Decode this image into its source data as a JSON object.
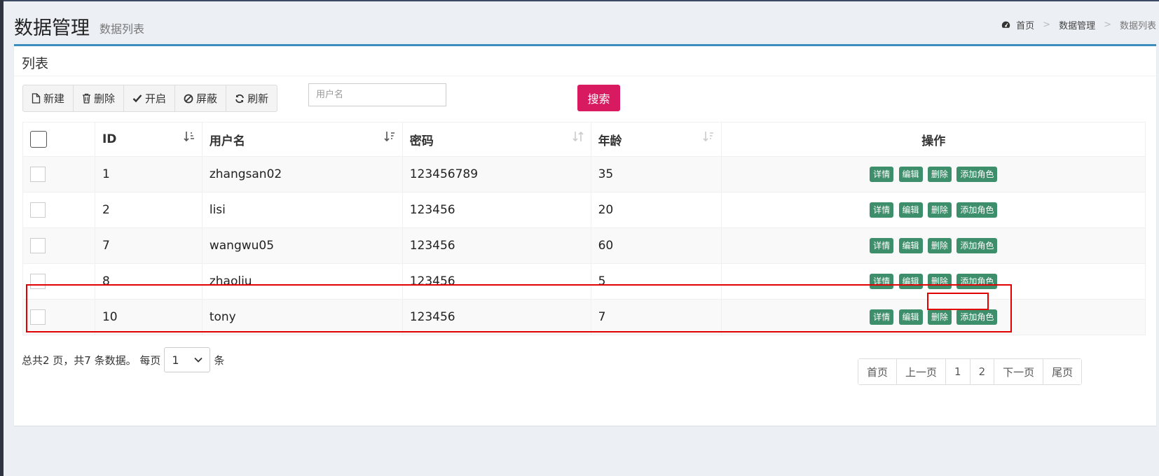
{
  "header": {
    "title": "数据管理",
    "subtitle": "数据列表",
    "breadcrumb": [
      "首页",
      "数据管理",
      "数据列表"
    ],
    "breadcrumb_sep": ">"
  },
  "box": {
    "title": "列表"
  },
  "toolbar": {
    "new_label": "新建",
    "delete_label": "删除",
    "enable_label": "开启",
    "block_label": "屏蔽",
    "refresh_label": "刷新"
  },
  "search": {
    "placeholder": "用户名",
    "button_label": "搜索"
  },
  "table": {
    "columns": [
      "ID",
      "用户名",
      "密码",
      "年龄",
      "操作"
    ],
    "action_labels": [
      "详情",
      "编辑",
      "删除",
      "添加角色"
    ],
    "rows": [
      {
        "id": "1",
        "username": "zhangsan02",
        "password": "123456789",
        "age": "35"
      },
      {
        "id": "2",
        "username": "lisi",
        "password": "123456",
        "age": "20"
      },
      {
        "id": "7",
        "username": "wangwu05",
        "password": "123456",
        "age": "60"
      },
      {
        "id": "8",
        "username": "zhaoliu",
        "password": "123456",
        "age": "5"
      },
      {
        "id": "10",
        "username": "tony",
        "password": "123456",
        "age": "7"
      }
    ]
  },
  "pagination": {
    "summary": "总共2 页，共7 条数据。 每页",
    "per_page_value": "1",
    "per_page_suffix": "条",
    "pages": [
      "首页",
      "上一页",
      "1",
      "2",
      "下一页",
      "尾页"
    ]
  },
  "colors": {
    "accent": "#3c8dbc",
    "search_button": "#d81b60",
    "action_button": "#3d8e6b",
    "highlight": "#e00000"
  }
}
